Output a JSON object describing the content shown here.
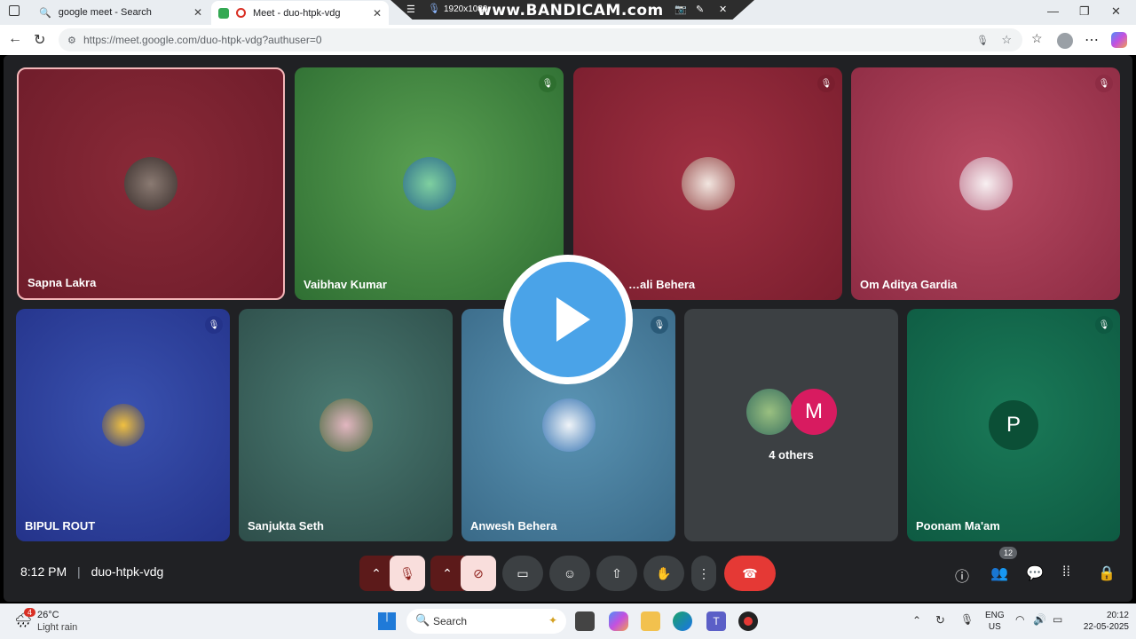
{
  "browser": {
    "tabs": [
      {
        "title": "google meet - Search",
        "active": false
      },
      {
        "title": "Meet - duo-htpk-vdg",
        "active": true
      }
    ],
    "recording_overlay": {
      "resolution": "1920x1080",
      "brand": "www.BANDICAM.com"
    },
    "url": "https://meet.google.com/duo-htpk-vdg?authuser=0"
  },
  "meet": {
    "participants_row1": [
      {
        "name": "Sapna Lakra",
        "muted": false,
        "bg": "#7a2130"
      },
      {
        "name": "Vaibhav Kumar",
        "muted": true,
        "bg": "#3f8a3a"
      },
      {
        "name": "…ali Behera",
        "muted": true,
        "bg": "#8a2436"
      },
      {
        "name": "Om Aditya Gardia",
        "muted": true,
        "bg": "#a33a55"
      }
    ],
    "participants_row2": [
      {
        "name": "BIPUL ROUT",
        "muted": true,
        "bg": "#2c3f93"
      },
      {
        "name": "Sanjukta Seth",
        "muted": false,
        "bg": "#3d6a62"
      },
      {
        "name": "Anwesh Behera",
        "muted": true,
        "bg": "#4f86a6"
      },
      {
        "name": "4 others",
        "letter": "M"
      },
      {
        "name": "Poonam Ma'am",
        "letter": "P",
        "muted": true,
        "bg": "#0d6b4a"
      }
    ],
    "time": "8:12 PM",
    "meeting_code": "duo-htpk-vdg",
    "participant_count": "12",
    "colors": {
      "end_call": "#e53935",
      "muted_control": "#f9dedc",
      "control_bg": "#3c4043"
    }
  },
  "taskbar": {
    "weather": {
      "temp": "26°C",
      "desc": "Light rain",
      "badge": "4"
    },
    "search_placeholder": "Search",
    "lang": "ENG",
    "region": "US",
    "time": "20:12",
    "date": "22-05-2025"
  }
}
